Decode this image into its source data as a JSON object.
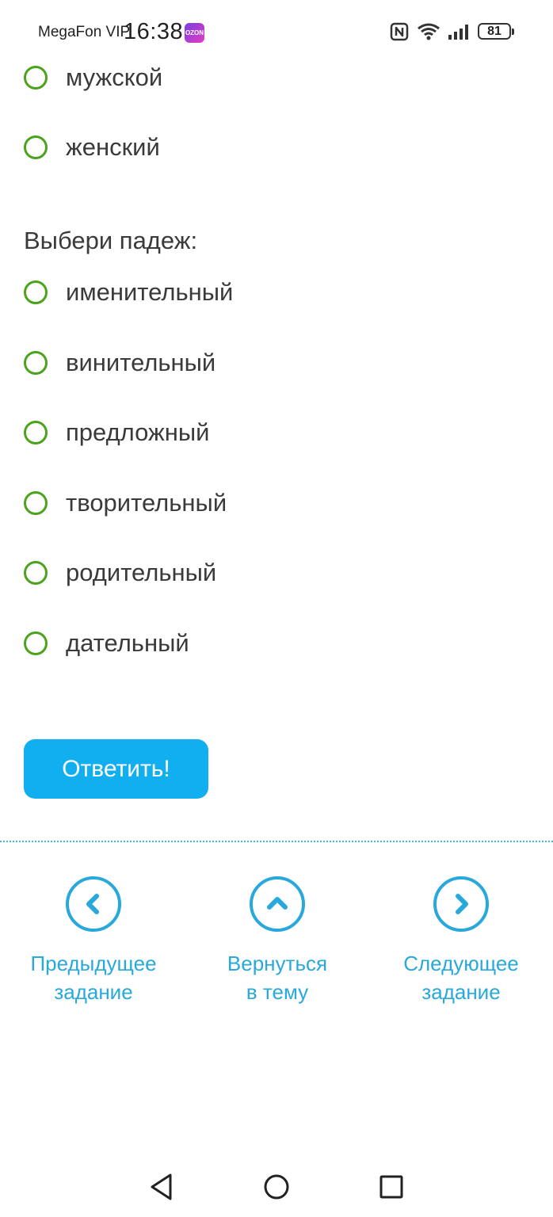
{
  "status_bar": {
    "carrier": "MegaFon VIP",
    "time": "16:38",
    "app_badge": "OZON",
    "battery": "81",
    "icons": [
      "nfc-icon",
      "wifi-icon",
      "signal-icon",
      "battery-icon"
    ]
  },
  "gender_options": [
    "мужской",
    "женский"
  ],
  "case_prompt": "Выбери падеж:",
  "case_options": [
    "именительный",
    "винительный",
    "предложный",
    "творительный",
    "родительный",
    "дательный"
  ],
  "answer_button": "Ответить!",
  "task_nav": {
    "prev": {
      "line1": "Предыдущее",
      "line2": "задание"
    },
    "topic": {
      "line1": "Вернуться",
      "line2": "в тему"
    },
    "next": {
      "line1": "Следующее",
      "line2": "задание"
    }
  },
  "colors": {
    "radio_border": "#4aa31a",
    "accent_button": "#11aff0",
    "nav_accent": "#29a8dc"
  }
}
